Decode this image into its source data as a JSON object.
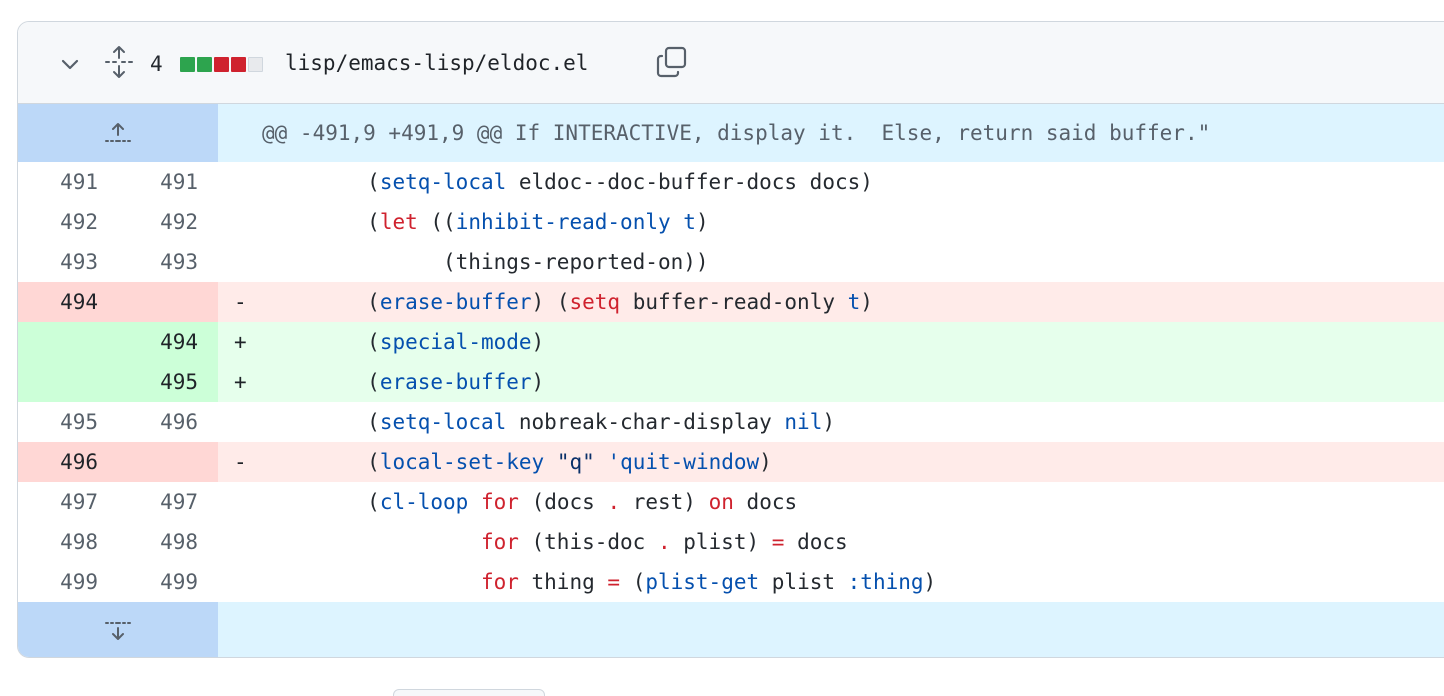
{
  "file": {
    "change_count": "4",
    "diffstat_blocks": [
      {
        "color": "#2da44e"
      },
      {
        "color": "#2da44e"
      },
      {
        "color": "#cf222e"
      },
      {
        "color": "#cf222e"
      },
      {
        "color": "#e8eaed"
      }
    ],
    "path": "lisp/emacs-lisp/eldoc.el",
    "icons": {
      "collapse": "chevron-down-icon",
      "expand": "unfold-icon",
      "copy": "copy-icon"
    }
  },
  "hunk_header": "@@ -491,9 +491,9 @@ If INTERACTIVE, display it.  Else, return said buffer.\"",
  "lines": [
    {
      "type": "ctx",
      "old": "491",
      "new": "491",
      "marker": "",
      "indent": "        ",
      "tokens": [
        {
          "t": "(",
          "c": "tl"
        },
        {
          "t": "setq-local",
          "c": "fn"
        },
        {
          "t": " eldoc--doc-buffer-docs docs)",
          "c": "tl"
        }
      ]
    },
    {
      "type": "ctx",
      "old": "492",
      "new": "492",
      "marker": "",
      "indent": "        ",
      "tokens": [
        {
          "t": "(",
          "c": "tl"
        },
        {
          "t": "let",
          "c": "rd"
        },
        {
          "t": " ((",
          "c": "tl"
        },
        {
          "t": "inhibit-read-only",
          "c": "fn"
        },
        {
          "t": " ",
          "c": "tl"
        },
        {
          "t": "t",
          "c": "fn"
        },
        {
          "t": ")",
          "c": "tl"
        }
      ]
    },
    {
      "type": "ctx",
      "old": "493",
      "new": "493",
      "marker": "",
      "indent": "              ",
      "tokens": [
        {
          "t": "(things-reported-on))",
          "c": "tl"
        }
      ]
    },
    {
      "type": "del",
      "old": "494",
      "new": "",
      "marker": "-",
      "indent": "        ",
      "tokens": [
        {
          "t": "(",
          "c": "tl"
        },
        {
          "t": "erase-buffer",
          "c": "fn"
        },
        {
          "t": ") (",
          "c": "tl"
        },
        {
          "t": "setq",
          "c": "rd"
        },
        {
          "t": " buffer-read-only ",
          "c": "tl"
        },
        {
          "t": "t",
          "c": "fn"
        },
        {
          "t": ")",
          "c": "tl"
        }
      ]
    },
    {
      "type": "add",
      "old": "",
      "new": "494",
      "marker": "+",
      "indent": "        ",
      "tokens": [
        {
          "t": "(",
          "c": "tl"
        },
        {
          "t": "special-mode",
          "c": "fn"
        },
        {
          "t": ")",
          "c": "tl"
        }
      ]
    },
    {
      "type": "add",
      "old": "",
      "new": "495",
      "marker": "+",
      "indent": "        ",
      "tokens": [
        {
          "t": "(",
          "c": "tl"
        },
        {
          "t": "erase-buffer",
          "c": "fn"
        },
        {
          "t": ")",
          "c": "tl"
        }
      ]
    },
    {
      "type": "ctx",
      "old": "495",
      "new": "496",
      "marker": "",
      "indent": "        ",
      "tokens": [
        {
          "t": "(",
          "c": "tl"
        },
        {
          "t": "setq-local",
          "c": "fn"
        },
        {
          "t": " nobreak-char-display ",
          "c": "tl"
        },
        {
          "t": "nil",
          "c": "fn"
        },
        {
          "t": ")",
          "c": "tl"
        }
      ]
    },
    {
      "type": "del",
      "old": "496",
      "new": "",
      "marker": "-",
      "indent": "        ",
      "tokens": [
        {
          "t": "(",
          "c": "tl"
        },
        {
          "t": "local-set-key",
          "c": "fn"
        },
        {
          "t": " ",
          "c": "tl"
        },
        {
          "t": "\"q\"",
          "c": "kw"
        },
        {
          "t": " ",
          "c": "tl"
        },
        {
          "t": "'quit-window",
          "c": "fn"
        },
        {
          "t": ")",
          "c": "tl"
        }
      ]
    },
    {
      "type": "ctx",
      "old": "497",
      "new": "497",
      "marker": "",
      "indent": "        ",
      "tokens": [
        {
          "t": "(",
          "c": "tl"
        },
        {
          "t": "cl-loop",
          "c": "fn"
        },
        {
          "t": " ",
          "c": "tl"
        },
        {
          "t": "for",
          "c": "rd"
        },
        {
          "t": " (docs ",
          "c": "tl"
        },
        {
          "t": ".",
          "c": "rd"
        },
        {
          "t": " rest) ",
          "c": "tl"
        },
        {
          "t": "on",
          "c": "rd"
        },
        {
          "t": " docs",
          "c": "tl"
        }
      ]
    },
    {
      "type": "ctx",
      "old": "498",
      "new": "498",
      "marker": "",
      "indent": "                 ",
      "tokens": [
        {
          "t": "for",
          "c": "rd"
        },
        {
          "t": " (this-doc ",
          "c": "tl"
        },
        {
          "t": ".",
          "c": "rd"
        },
        {
          "t": " plist) ",
          "c": "tl"
        },
        {
          "t": "=",
          "c": "rd"
        },
        {
          "t": " docs",
          "c": "tl"
        }
      ]
    },
    {
      "type": "ctx",
      "old": "499",
      "new": "499",
      "marker": "",
      "indent": "                 ",
      "tokens": [
        {
          "t": "for",
          "c": "rd"
        },
        {
          "t": " thing ",
          "c": "tl"
        },
        {
          "t": "=",
          "c": "rd"
        },
        {
          "t": " (",
          "c": "tl"
        },
        {
          "t": "plist-get",
          "c": "fn"
        },
        {
          "t": " plist ",
          "c": "tl"
        },
        {
          "t": ":thing",
          "c": "fn"
        },
        {
          "t": ")",
          "c": "tl"
        }
      ]
    }
  ]
}
